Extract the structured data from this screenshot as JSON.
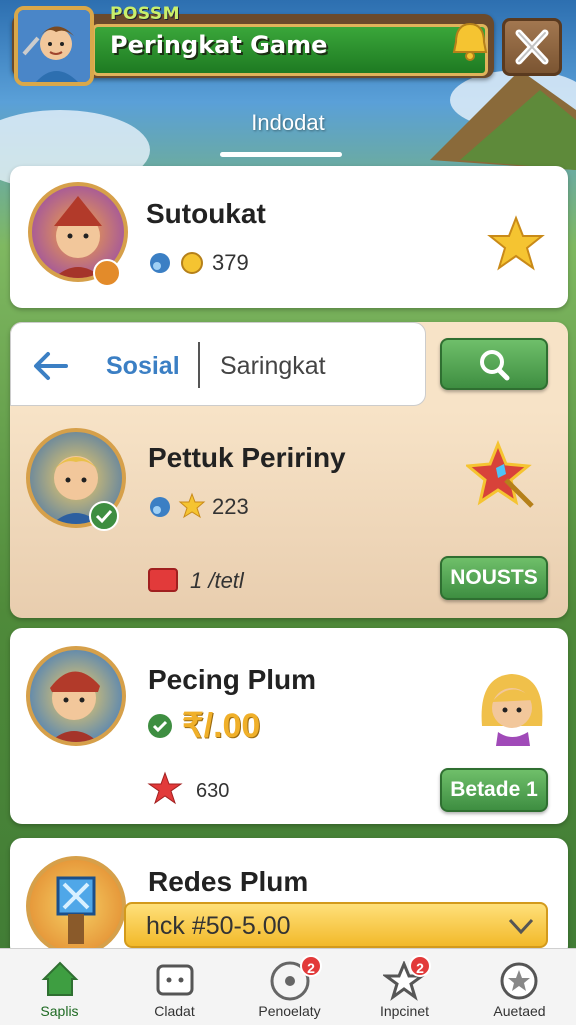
{
  "header": {
    "tag": "POSSM",
    "title": "Peringkat  Game"
  },
  "tab": {
    "label": "Indodat"
  },
  "player_top": {
    "name": "Sutoukat",
    "score": "379"
  },
  "search": {
    "tab_social": "Sosial",
    "tab_ranking": "Saringkat"
  },
  "player_2": {
    "name": "Pettuk Peririny",
    "score": "223",
    "reward": "1 /tetl",
    "button": "NOUSTS"
  },
  "player_3": {
    "name": "Pecing Plum",
    "price": "₹/.00",
    "score": "630",
    "button": "Betade 1"
  },
  "player_4": {
    "name": "Redes Plum",
    "price": "hck #50-5.00"
  },
  "nav": {
    "items": [
      {
        "label": "Saplis"
      },
      {
        "label": "Cladat"
      },
      {
        "label": "Penoelaty",
        "badge": "2"
      },
      {
        "label": "Inpcinet",
        "badge": "2"
      },
      {
        "label": "Auetaed"
      }
    ]
  },
  "colors": {
    "accent_green": "#3e8e41",
    "gold": "#e0b35a",
    "brand_blue": "#3b7fc4"
  }
}
